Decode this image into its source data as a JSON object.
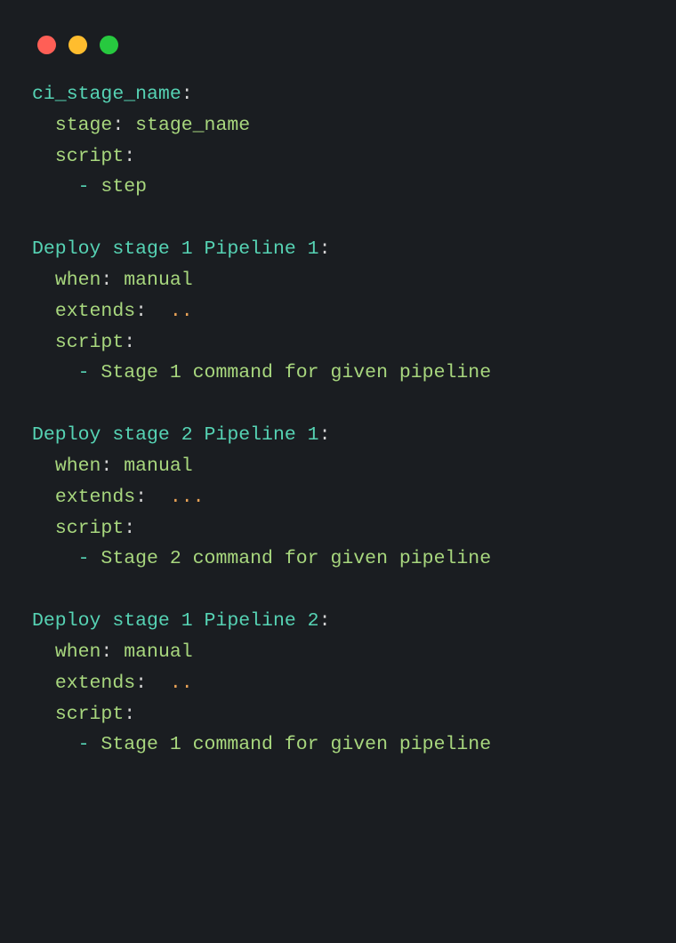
{
  "window": {
    "dots": [
      "red",
      "yellow",
      "green"
    ]
  },
  "code": {
    "blocks": [
      {
        "header": "ci_stage_name",
        "lines": [
          {
            "indent": "  ",
            "key": "stage",
            "value": "stage_name",
            "valueClass": "val-green"
          },
          {
            "indent": "  ",
            "key": "script",
            "value": ""
          },
          {
            "indent": "    ",
            "dash": "-",
            "value": "step",
            "valueClass": "val-green"
          }
        ]
      },
      {
        "header": "Deploy stage 1 Pipeline 1",
        "lines": [
          {
            "indent": "  ",
            "key": "when",
            "value": "manual",
            "valueClass": "val-green"
          },
          {
            "indent": "  ",
            "key": "extends",
            "value": " ..",
            "valueClass": "orange"
          },
          {
            "indent": "  ",
            "key": "script",
            "value": ""
          },
          {
            "indent": "    ",
            "dash": "-",
            "value": "Stage 1 command for given pipeline",
            "valueClass": "val-green"
          }
        ]
      },
      {
        "header": "Deploy stage 2 Pipeline 1",
        "lines": [
          {
            "indent": "  ",
            "key": "when",
            "value": "manual",
            "valueClass": "val-green"
          },
          {
            "indent": "  ",
            "key": "extends",
            "value": " ...",
            "valueClass": "orange"
          },
          {
            "indent": "  ",
            "key": "script",
            "value": ""
          },
          {
            "indent": "    ",
            "dash": "-",
            "value": "Stage 2 command for given pipeline",
            "valueClass": "val-green"
          }
        ]
      },
      {
        "header": "Deploy stage 1 Pipeline 2",
        "lines": [
          {
            "indent": "  ",
            "key": "when",
            "value": "manual",
            "valueClass": "val-green"
          },
          {
            "indent": "  ",
            "key": "extends",
            "value": " ..",
            "valueClass": "orange"
          },
          {
            "indent": "  ",
            "key": "script",
            "value": ""
          },
          {
            "indent": "    ",
            "dash": "-",
            "value": "Stage 1 command for given pipeline",
            "valueClass": "val-green"
          }
        ]
      }
    ]
  }
}
